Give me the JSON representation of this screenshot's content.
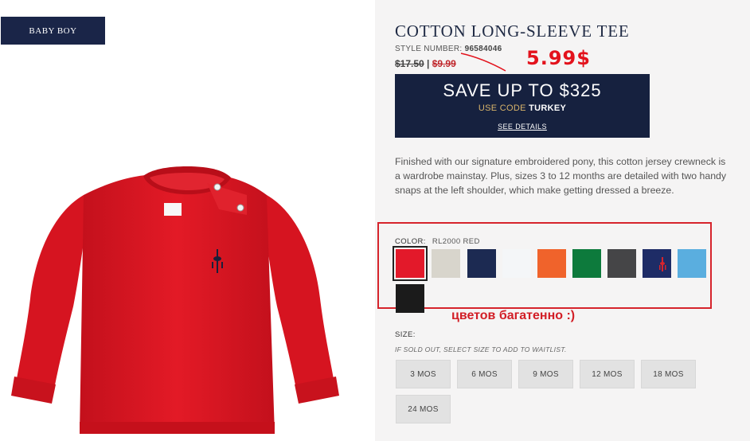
{
  "left": {
    "badge": "BABY BOY",
    "image_alt": "red long-sleeve tee"
  },
  "product": {
    "title": "COTTON LONG-SLEEVE TEE",
    "style_label": "STYLE NUMBER:",
    "style_number": "96584046",
    "old_price": "$17.50",
    "separator": "|",
    "sale_price": "$9.99",
    "annotation_price": "5.99$",
    "description": "Finished with our signature embroidered pony, this cotton jersey crewneck is a wardrobe mainstay. Plus, sizes 3 to 12 months are detailed with two handy snaps at the left shoulder, which make getting dressed a breeze."
  },
  "promo": {
    "headline": "SAVE UP TO $325",
    "code_prefix": "USE CODE",
    "code": "TURKEY",
    "details_link": "SEE DETAILS"
  },
  "color": {
    "label": "COLOR:",
    "selected_value": "RL2000 RED",
    "annotation": "цветов багатенно :)",
    "swatches": [
      {
        "name": "red",
        "hex": "#e3192a",
        "pony": false
      },
      {
        "name": "oatmeal heather",
        "hex": "#d8d5cc",
        "pony": false
      },
      {
        "name": "navy",
        "hex": "#1c2a52",
        "pony": false
      },
      {
        "name": "white",
        "hex": "#f4f6f8",
        "pony": false
      },
      {
        "name": "orange",
        "hex": "#f0632b",
        "pony": false
      },
      {
        "name": "green",
        "hex": "#0d7a3c",
        "pony": false
      },
      {
        "name": "charcoal",
        "hex": "#454547",
        "pony": false
      },
      {
        "name": "navy pony",
        "hex": "#1e2c66",
        "pony": true
      },
      {
        "name": "sky blue",
        "hex": "#5aaedf",
        "pony": false
      },
      {
        "name": "black",
        "hex": "#1b1b1b",
        "pony": false
      }
    ]
  },
  "size": {
    "label": "SIZE:",
    "note": "IF SOLD OUT, SELECT SIZE TO ADD TO WAITLIST.",
    "options": [
      "3 MOS",
      "6 MOS",
      "9 MOS",
      "12 MOS",
      "18 MOS",
      "24 MOS"
    ]
  },
  "colors": {
    "navy_badge": "#1a2548",
    "promo_bg": "#16213f",
    "annotation_red": "#e3121c",
    "panel_bg": "#f5f4f4"
  }
}
